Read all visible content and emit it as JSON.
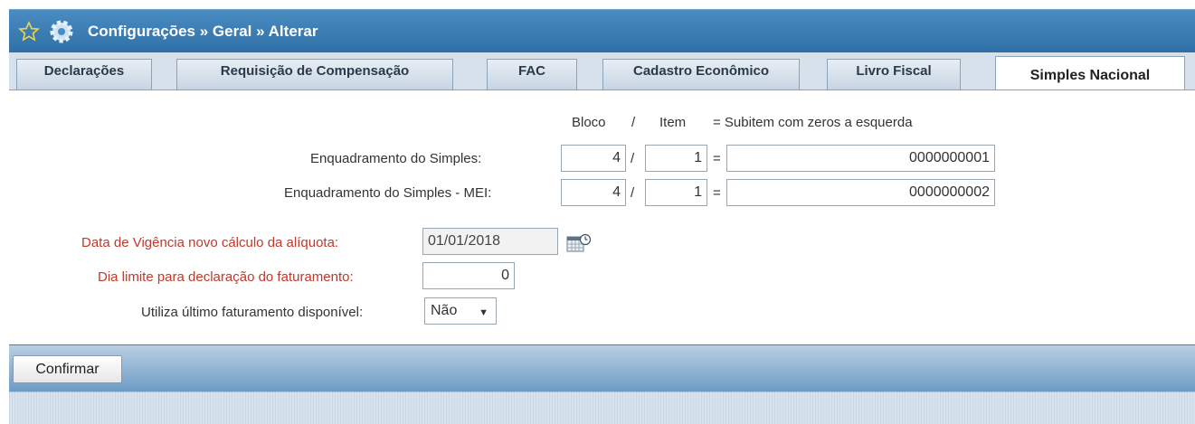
{
  "header": {
    "title": "Configurações » Geral » Alterar",
    "star_icon": "star-icon",
    "gear_icon": "gear-icon"
  },
  "tabs": [
    {
      "label": "Declarações"
    },
    {
      "label": "Requisição de Compensação"
    },
    {
      "label": "FAC"
    },
    {
      "label": "Cadastro Econômico"
    },
    {
      "label": "Livro Fiscal"
    },
    {
      "label": "Simples Nacional",
      "active": true
    }
  ],
  "form": {
    "col_headers": {
      "bloco": "Bloco",
      "slash": "/",
      "item": "Item",
      "subitem": "= Subitem com zeros a esquerda"
    },
    "rows": [
      {
        "label": "Enquadramento do Simples:",
        "bloco": "4",
        "item": "1",
        "subitem": "0000000001"
      },
      {
        "label": "Enquadramento do Simples - MEI:",
        "bloco": "4",
        "item": "1",
        "subitem": "0000000002"
      }
    ],
    "sep_slash": "/",
    "sep_eq": "=",
    "vigencia": {
      "label": "Data de Vigência novo cálculo da alíquota:",
      "value": "01/01/2018"
    },
    "dia_limite": {
      "label": "Dia limite para declaração do faturamento:",
      "value": "0"
    },
    "ultimo": {
      "label": "Utiliza último faturamento disponível:",
      "value": "Não",
      "arrow": "▼"
    }
  },
  "footer": {
    "confirm_label": "Confirmar"
  }
}
